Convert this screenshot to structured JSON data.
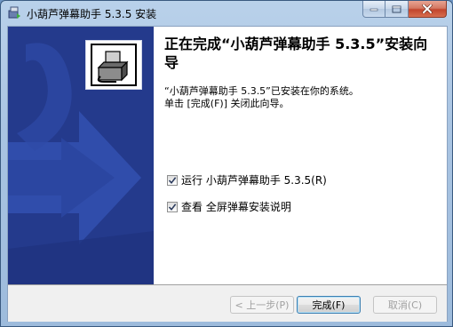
{
  "window": {
    "title": "小葫芦弹幕助手 5.3.5 安装"
  },
  "page": {
    "heading": "正在完成“小葫芦弹幕助手 5.3.5”安装向导",
    "line1": "“小葫芦弹幕助手 5.3.5”已安装在你的系统。",
    "line2": "单击 [完成(F)] 关闭此向导。"
  },
  "options": [
    {
      "label": "运行 小葫芦弹幕助手 5.3.5(R)",
      "checked": true
    },
    {
      "label": "查看 全屏弹幕安装说明",
      "checked": true
    }
  ],
  "buttons": {
    "back": "< 上一步(P)",
    "finish": "完成(F)",
    "cancel": "取消(C)"
  },
  "colors": {
    "banner": "#243a8c",
    "banner_arrow": "#3351b0"
  },
  "icons": {
    "app": "installer-icon",
    "logo": "nsis-installer-logo-icon"
  }
}
